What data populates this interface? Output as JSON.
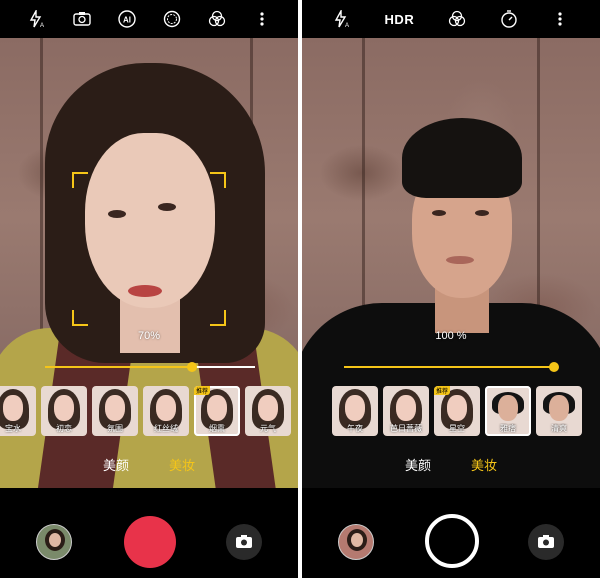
{
  "left": {
    "topbar_icons": [
      "flash-auto-icon",
      "camera-switch-icon",
      "ai-icon",
      "aperture-icon",
      "filter-icon",
      "more-icon"
    ],
    "ai_label": "AI",
    "beauty_percent": "70%",
    "beauty_level": 0.7,
    "thumbnails": [
      {
        "label": "宝水",
        "tag": "",
        "selected": false
      },
      {
        "label": "初恋",
        "tag": "",
        "selected": false
      },
      {
        "label": "氛围",
        "tag": "",
        "selected": false
      },
      {
        "label": "红丝绒",
        "tag": "",
        "selected": false
      },
      {
        "label": "烟熏",
        "tag": "推荐",
        "selected": true
      },
      {
        "label": "元气",
        "tag": "",
        "selected": false
      }
    ],
    "modes": [
      "美颜",
      "美妆"
    ],
    "active_mode": "美妆"
  },
  "right": {
    "topbar_icons": [
      "flash-auto-icon",
      "hdr-icon",
      "filter-icon",
      "timer-icon",
      "more-icon"
    ],
    "hdr_label": "HDR",
    "beauty_percent": "100 %",
    "beauty_level": 1.0,
    "thumbnails": [
      {
        "label": "午夜",
        "tag": "",
        "selected": false
      },
      {
        "label": "芭日蔷薇",
        "tag": "",
        "selected": false
      },
      {
        "label": "星空",
        "tag": "推荐",
        "selected": false
      },
      {
        "label": "雅痞",
        "tag": "",
        "selected": true
      },
      {
        "label": "清爽",
        "tag": "",
        "selected": false
      }
    ],
    "modes": [
      "美颜",
      "美妆"
    ],
    "active_mode": "美妆"
  },
  "colors": {
    "accent": "#f5c518",
    "shutter_red": "#e8334a"
  }
}
